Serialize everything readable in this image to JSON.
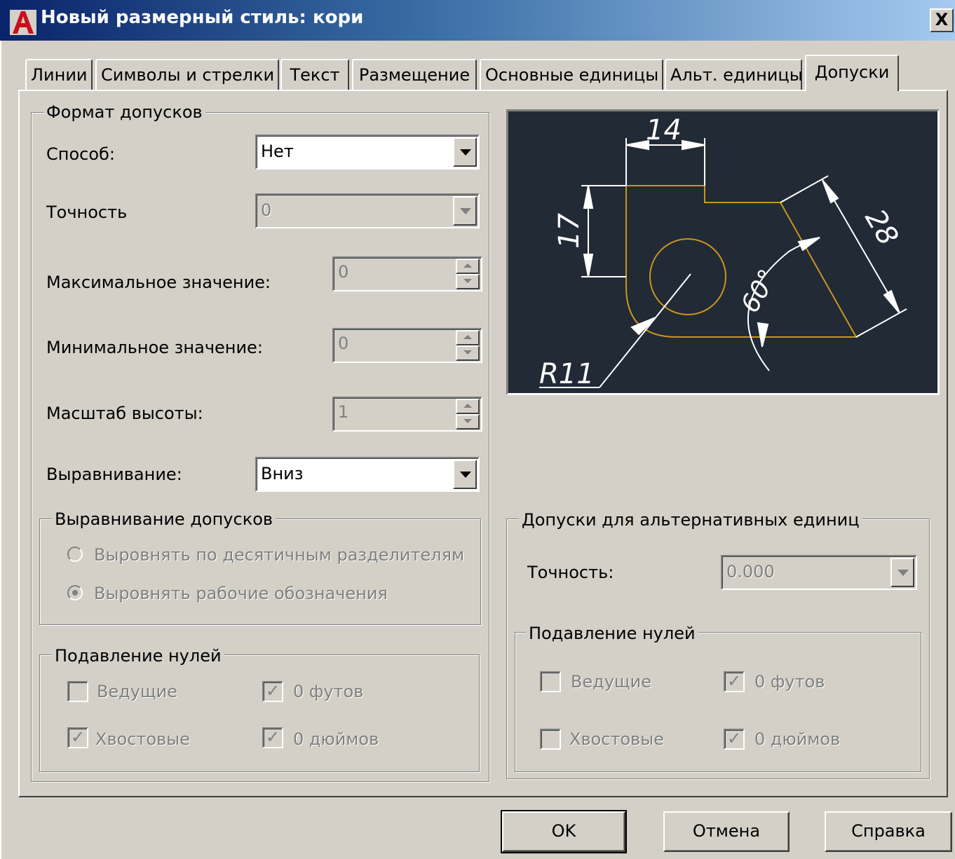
{
  "window": {
    "title": "Новый размерный стиль: кори",
    "close_glyph": "X"
  },
  "tabs": [
    {
      "label": "Линии"
    },
    {
      "label": "Символы и стрелки"
    },
    {
      "label": "Текст"
    },
    {
      "label": "Размещение"
    },
    {
      "label": "Основные единицы"
    },
    {
      "label": "Альт. единицы"
    },
    {
      "label": "Допуски",
      "active": true
    }
  ],
  "tolerance_format": {
    "legend": "Формат допусков",
    "method_label": "Способ:",
    "method_value": "Нет",
    "precision_label": "Точность",
    "precision_value": "0",
    "max_label": "Максимальное значение:",
    "max_value": "0",
    "min_label": "Минимальное значение:",
    "min_value": "0",
    "height_scale_label": "Масштаб высоты:",
    "height_scale_value": "1",
    "vertical_position_label": "Выравнивание:",
    "vertical_position_value": "Вниз"
  },
  "tolerance_alignment": {
    "legend": "Выравнивание допусков",
    "option_decimal": "Выровнять по десятичным разделителям",
    "option_operational": "Выровнять рабочие обозначения",
    "selected": "option_operational"
  },
  "zero_suppression": {
    "legend": "Подавление нулей",
    "leading_label": "Ведущие",
    "leading_checked": false,
    "trailing_label": "Хвостовые",
    "trailing_checked": true,
    "feet_label": "0 футов",
    "feet_checked": true,
    "inches_label": "0 дюймов",
    "inches_checked": true
  },
  "alt_tolerance": {
    "legend": "Допуски для альтернативных единиц",
    "precision_label": "Точность:",
    "precision_value": "0.000"
  },
  "alt_zero_suppression": {
    "legend": "Подавление нулей",
    "leading_label": "Ведущие",
    "leading_checked": false,
    "trailing_label": "Хвостовые",
    "trailing_checked": false,
    "feet_label": "0 футов",
    "feet_checked": true,
    "inches_label": "0 дюймов",
    "inches_checked": true
  },
  "preview": {
    "dim_horizontal": "14",
    "dim_vertical": "17",
    "dim_aligned": "28",
    "dim_angle": "60°",
    "dim_radius": "R11",
    "colors": {
      "background": "#222a35",
      "geometry": "#c8961e",
      "dimensions": "#ffffff"
    }
  },
  "buttons": {
    "ok": "OK",
    "cancel": "Отмена",
    "help": "Справка"
  },
  "check_glyph": "✓"
}
